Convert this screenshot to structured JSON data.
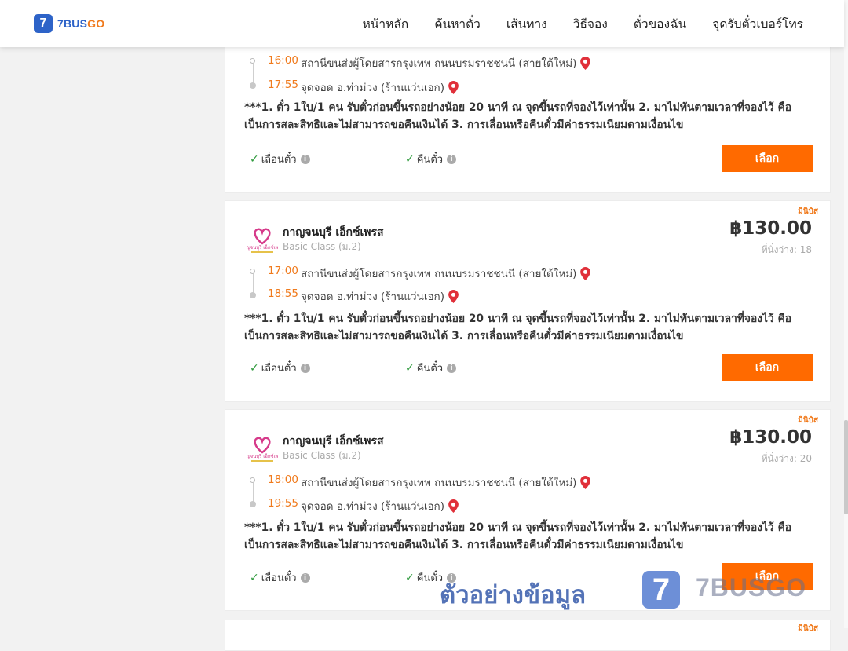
{
  "brand": {
    "badge": "7",
    "name_part1": "7BUS",
    "name_part2": "GO"
  },
  "nav": {
    "items": [
      "หน้าหลัก",
      "ค้นหาตั๋ว",
      "เส้นทาง",
      "วิธีจอง",
      "ตั๋วของฉัน",
      "จุดรับตั๋วเบอร์โทร"
    ]
  },
  "trips": [
    {
      "depart_time": "16:00",
      "depart_place": "สถานีขนส่งผู้โดยสารกรุงเทพ ถนนบรมราชชนนี (สายใต้ใหม่)",
      "arrive_time": "17:55",
      "arrive_place": "จุดจอด อ.ท่าม่วง (ร้านแว่นเอก)",
      "note": "***1. ตั๋ว 1ใบ/1 คน รับตั๋วก่อนขึ้นรถอย่างน้อย 20 นาที ณ จุดขึ้นรถที่จองไว้เท่านั้น 2. มาไม่ทันตามเวลาที่จองไว้ คือเป็นการสละสิทธิและไม่สามารถขอคืนเงินได้ 3. การเลื่อนหรือคืนตั๋วมีค่าธรรมเนียมตามเงื่อนไข",
      "change_label": "เลื่อนตั๋ว",
      "refund_label": "คืนตั๋ว",
      "select_label": "เลือก"
    },
    {
      "tag": "มินิบัส",
      "operator": "กาญจนบุรี เอ็กซ์เพรส",
      "logo_text": "กาญจนบุรี เอ็กซ์เพรส",
      "class": "Basic Class (ม.2)",
      "price": "฿130.00",
      "seats": "ที่นั่งว่าง: 18",
      "depart_time": "17:00",
      "depart_place": "สถานีขนส่งผู้โดยสารกรุงเทพ ถนนบรมราชชนนี (สายใต้ใหม่)",
      "arrive_time": "18:55",
      "arrive_place": "จุดจอด อ.ท่าม่วง (ร้านแว่นเอก)",
      "note": "***1. ตั๋ว 1ใบ/1 คน รับตั๋วก่อนขึ้นรถอย่างน้อย 20 นาที ณ จุดขึ้นรถที่จองไว้เท่านั้น 2. มาไม่ทันตามเวลาที่จองไว้ คือเป็นการสละสิทธิและไม่สามารถขอคืนเงินได้ 3. การเลื่อนหรือคืนตั๋วมีค่าธรรมเนียมตามเงื่อนไข",
      "change_label": "เลื่อนตั๋ว",
      "refund_label": "คืนตั๋ว",
      "select_label": "เลือก"
    },
    {
      "tag": "มินิบัส",
      "operator": "กาญจนบุรี เอ็กซ์เพรส",
      "logo_text": "กาญจนบุรี เอ็กซ์เพรส",
      "class": "Basic Class (ม.2)",
      "price": "฿130.00",
      "seats": "ที่นั่งว่าง: 20",
      "depart_time": "18:00",
      "depart_place": "สถานีขนส่งผู้โดยสารกรุงเทพ ถนนบรมราชชนนี (สายใต้ใหม่)",
      "arrive_time": "19:55",
      "arrive_place": "จุดจอด อ.ท่าม่วง (ร้านแว่นเอก)",
      "note": "***1. ตั๋ว 1ใบ/1 คน รับตั๋วก่อนขึ้นรถอย่างน้อย 20 นาที ณ จุดขึ้นรถที่จองไว้เท่านั้น 2. มาไม่ทันตามเวลาที่จองไว้ คือเป็นการสละสิทธิและไม่สามารถขอคืนเงินได้ 3. การเลื่อนหรือคืนตั๋วมีค่าธรรมเนียมตามเงื่อนไข",
      "change_label": "เลื่อนตั๋ว",
      "refund_label": "คืนตั๋ว",
      "select_label": "เลือก"
    },
    {
      "tag": "มินิบัส"
    }
  ],
  "watermark": {
    "text": "ตัวอย่างข้อมูล",
    "badge": "7",
    "name": "7BUSGO"
  },
  "colors": {
    "accent": "#ff6a00",
    "brand_blue": "#2d63c8",
    "time": "#f07a1c",
    "pin": "#e0303a"
  }
}
